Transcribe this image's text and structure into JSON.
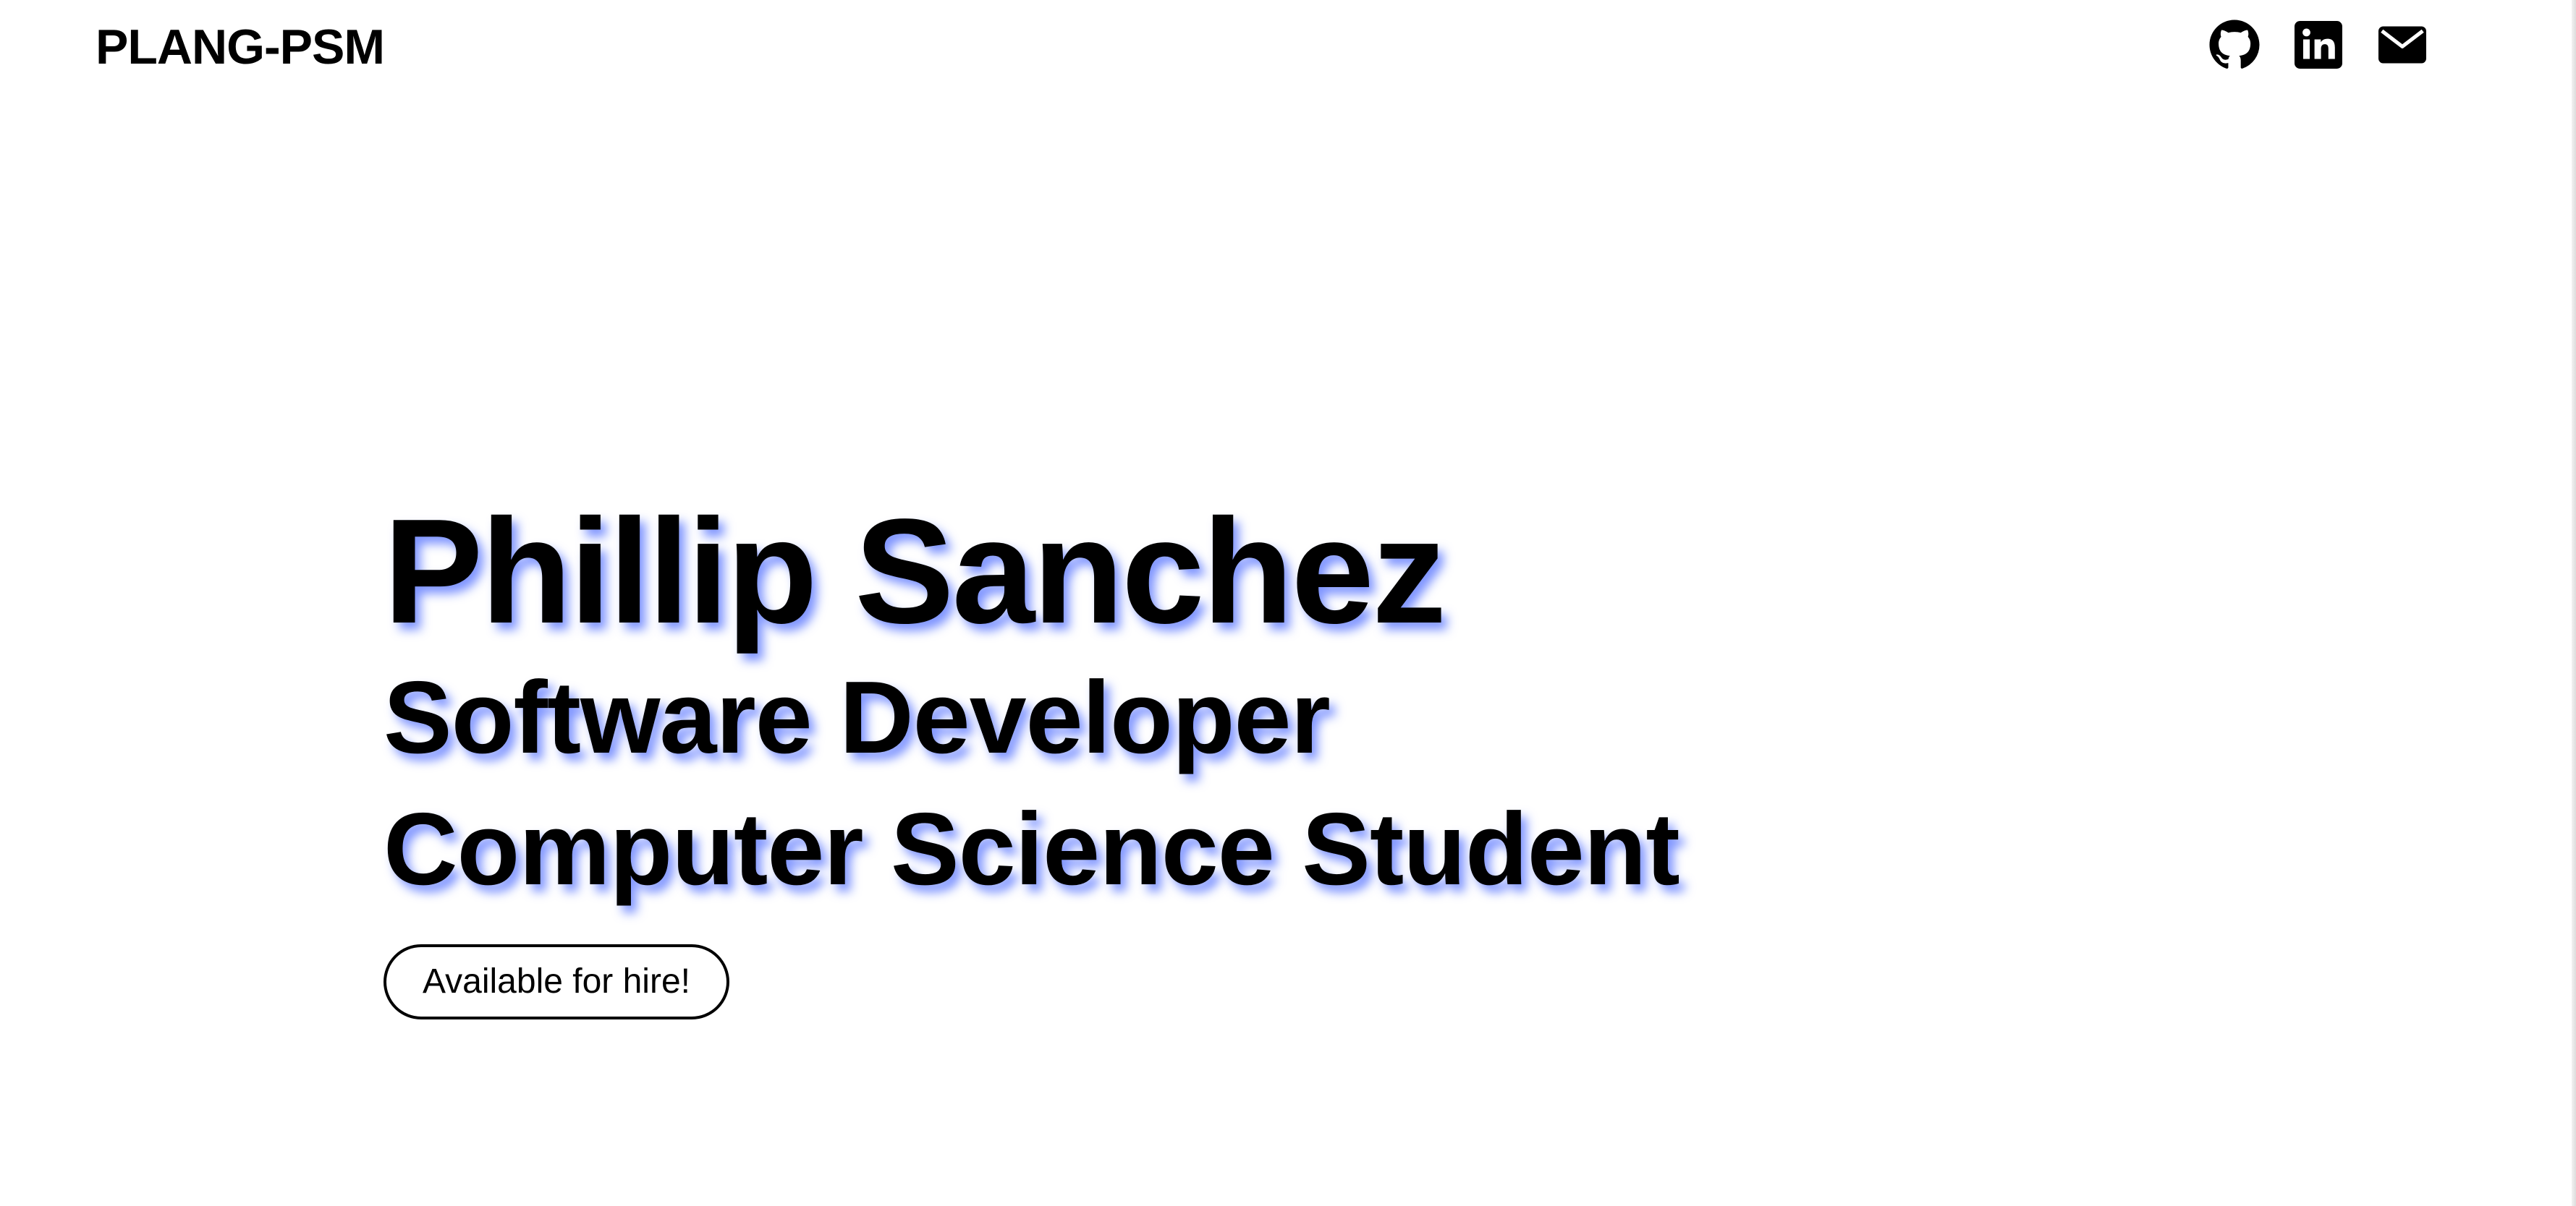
{
  "header": {
    "brand": "PLANG-PSM",
    "social": [
      {
        "icon": "github-icon",
        "label": "GitHub"
      },
      {
        "icon": "linkedin-icon",
        "label": "LinkedIn"
      },
      {
        "icon": "envelope-icon",
        "label": "Email"
      }
    ]
  },
  "hero": {
    "name": "Phillip Sanchez",
    "lines": [
      "Software Developer",
      "Computer Science Student"
    ],
    "cta_label": "Available for hire!"
  },
  "colors": {
    "background": "#ffffff",
    "text": "#000000",
    "shadow": "#143cff"
  }
}
